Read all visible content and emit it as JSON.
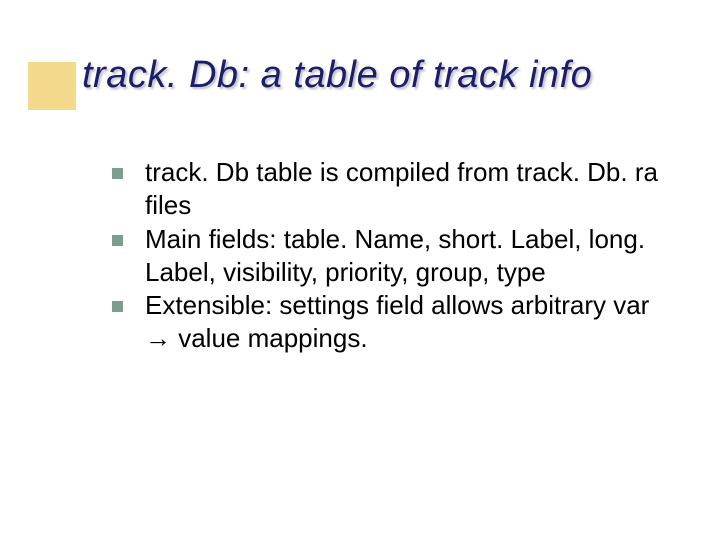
{
  "title": "track. Db: a table of track info",
  "bullets": [
    {
      "text": "track. Db table is compiled from track. Db. ra files"
    },
    {
      "text": "Main fields: table. Name, short. Label, long. Label, visibility, priority, group, type"
    },
    {
      "text": "Extensible: settings field allows arbitrary var → value mappings."
    }
  ]
}
